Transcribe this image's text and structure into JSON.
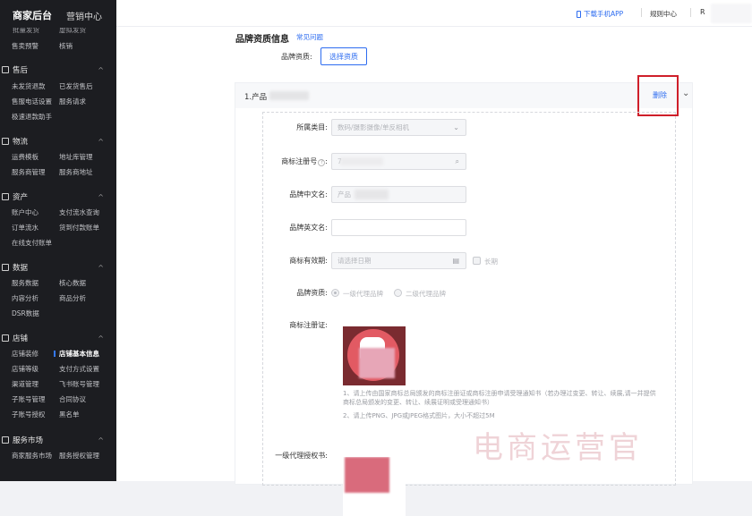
{
  "sidebar": {
    "top_tabs": [
      "商家后台",
      "营销中心"
    ],
    "clipped_row": [
      "批量发货",
      "虚拟发货"
    ],
    "row0": [
      "售卖预警",
      "核销"
    ],
    "sections": [
      {
        "title": "售后",
        "items": [
          [
            "未发货退款",
            "已发货售后"
          ],
          [
            "售服电话设置",
            "服务请求"
          ],
          [
            "极速退款助手",
            ""
          ]
        ]
      },
      {
        "title": "物流",
        "items": [
          [
            "运费模板",
            "地址库管理"
          ],
          [
            "服务商管理",
            "服务商地址"
          ]
        ]
      },
      {
        "title": "资产",
        "items": [
          [
            "账户中心",
            "支付流水查询"
          ],
          [
            "订单流水",
            "货到付款账单"
          ],
          [
            "在线支付账单",
            ""
          ]
        ]
      },
      {
        "title": "数据",
        "items": [
          [
            "服务数据",
            "核心数据"
          ],
          [
            "内容分析",
            "商品分析"
          ],
          [
            "DSR数据",
            ""
          ]
        ]
      },
      {
        "title": "店铺",
        "items": [
          [
            "店铺装修",
            "店铺基本信息"
          ],
          [
            "店铺等级",
            "支付方式设置"
          ],
          [
            "渠道管理",
            "飞书账号管理"
          ],
          [
            "子账号管理",
            "合同协议"
          ],
          [
            "子账号授权",
            "黑名单"
          ]
        ]
      },
      {
        "title": "服务市场",
        "items": [
          [
            "商家服务市场",
            "服务授权管理"
          ]
        ]
      }
    ]
  },
  "topbar": {
    "download_app": "下载手机APP",
    "rules_center": "规则中心",
    "user_initial": "R"
  },
  "main": {
    "section_title": "品牌资质信息",
    "faq_link": "常见问题",
    "qualification_label": "品牌资质:",
    "select_button": "选择资质",
    "card": {
      "title": "1.产品",
      "delete_label": "删除",
      "fields": {
        "category_label": "所属类目:",
        "category_value": "数码/摄影摄像/单反相机",
        "reg_no_label": "商标注册号",
        "reg_no_colon": ":",
        "reg_no_value": "7",
        "cn_name_label": "品牌中文名:",
        "cn_name_value": "产品",
        "en_name_label": "品牌英文名:",
        "en_name_value": "",
        "valid_label": "商标有效期:",
        "valid_placeholder": "请选择日期",
        "long_term": "长期",
        "qual_label": "品牌资质:",
        "qual_option1": "一级代理品牌",
        "qual_option2": "二级代理品牌",
        "cert_label": "商标注册证:",
        "note1": "1、请上传由国家商标总局颁发的商标注册证或商标注册申请受理通知书（若办理过变更、转让、续展,请一并提供商标总局颁发的变更、转让、续展证明或受理通知书）",
        "note2": "2、请上传PNG、JPG或JPEG格式图片，大小不超过5M",
        "auth_label": "一级代理授权书:"
      }
    }
  },
  "watermark": "电商运营官"
}
